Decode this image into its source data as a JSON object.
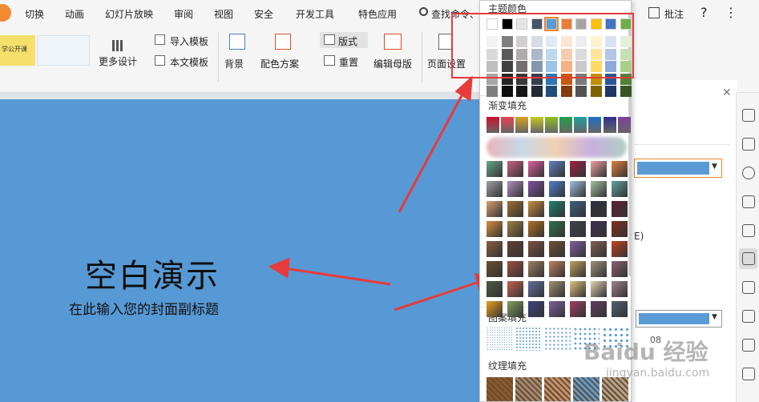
{
  "menubar": {
    "items": [
      "切换",
      "动画",
      "幻灯片放映",
      "审阅",
      "视图",
      "安全",
      "开发工具",
      "特色应用"
    ],
    "search_label": "查找命令、",
    "annotate_label": "批注",
    "help_label": "?",
    "more_label": "⋮"
  },
  "ribbon": {
    "more_design": "更多设计",
    "import_template": "导入模板",
    "text_template": "本文模板",
    "background": "背景",
    "color_scheme": "配色方案",
    "layout": "版式",
    "reset": "重置",
    "edit_master": "编辑母版",
    "page_setup": "页面设置",
    "thumb1_text": "学公开课"
  },
  "slide": {
    "title": "空白演示",
    "subtitle": "在此输入您的封面副标题"
  },
  "dropdown": {
    "theme_colors_label": "主题颜色",
    "gradient_label": "渐变填充",
    "pattern_label": "图案填充",
    "texture_label": "纹理填充"
  },
  "panel": {
    "fill_color": "#5b9bd5",
    "pattern_color": "#5b9bd5",
    "percent_partial": "08",
    "radio_partial": "E)"
  },
  "watermark": {
    "logo": "Baidu 经验",
    "url": "jingyan.baidu.com"
  },
  "colors": {
    "slide_bg": "#5799d4",
    "highlight": "#e83a3a",
    "accent": "#2b6dd1"
  }
}
